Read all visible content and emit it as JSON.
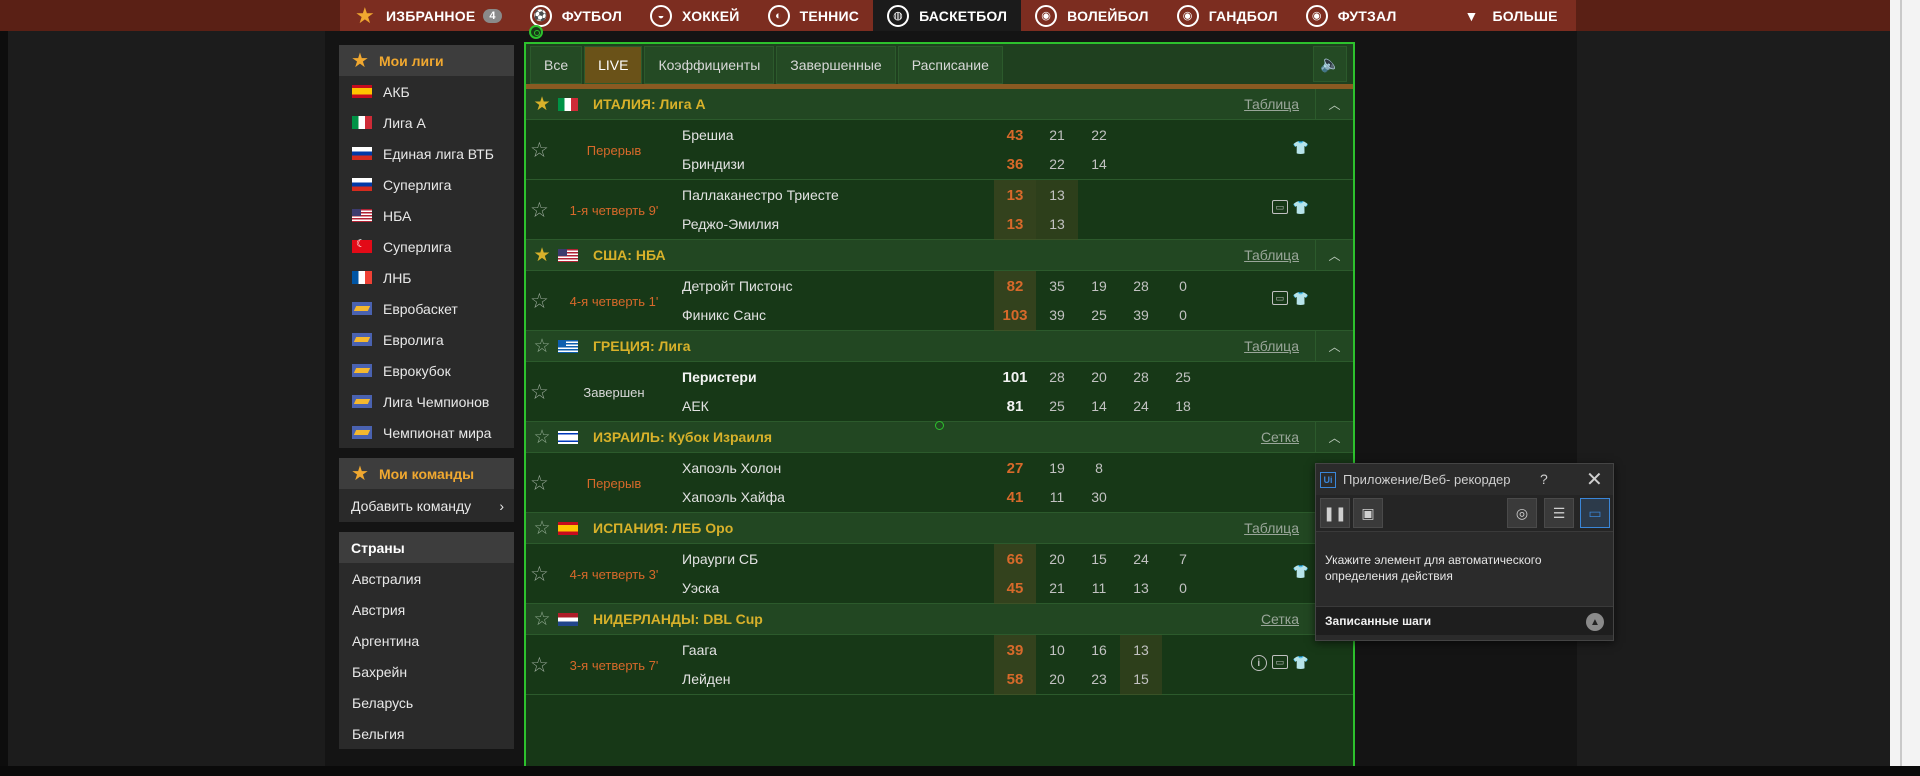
{
  "top_nav": {
    "items": [
      {
        "label": "ИЗБРАННОЕ",
        "icon": "star-icon",
        "badge": "4"
      },
      {
        "label": "ФУТБОЛ",
        "icon": "soccer-ball-icon"
      },
      {
        "label": "ХОККЕЙ",
        "icon": "hockey-puck-icon"
      },
      {
        "label": "ТЕННИС",
        "icon": "tennis-ball-icon"
      },
      {
        "label": "БАСКЕТБОЛ",
        "icon": "basketball-icon",
        "active": true
      },
      {
        "label": "ВОЛЕЙБОЛ",
        "icon": "volleyball-icon"
      },
      {
        "label": "ГАНДБОЛ",
        "icon": "handball-icon"
      },
      {
        "label": "ФУТЗАЛ",
        "icon": "futsal-ball-icon"
      },
      {
        "label": "БОЛЬШЕ",
        "icon": "triangle-down-icon"
      }
    ]
  },
  "sidebar": {
    "my_leagues_title": "Мои лиги",
    "leagues": [
      {
        "label": "АКБ",
        "flag": "es"
      },
      {
        "label": "Лига А",
        "flag": "it"
      },
      {
        "label": "Единая лига ВТБ",
        "flag": "ru"
      },
      {
        "label": "Суперлига",
        "flag": "ru"
      },
      {
        "label": "НБА",
        "flag": "us"
      },
      {
        "label": "Суперлига",
        "flag": "tr"
      },
      {
        "label": "ЛНБ",
        "flag": "fr"
      },
      {
        "label": "Евробаскет",
        "flag": "eu"
      },
      {
        "label": "Евролига",
        "flag": "eu"
      },
      {
        "label": "Еврокубок",
        "flag": "eu"
      },
      {
        "label": "Лига Чемпионов",
        "flag": "eu"
      },
      {
        "label": "Чемпионат мира",
        "flag": "eu"
      }
    ],
    "my_teams_title": "Мои команды",
    "add_team": "Добавить команду",
    "countries_title": "Страны",
    "countries": [
      "Австралия",
      "Австрия",
      "Аргентина",
      "Бахрейн",
      "Беларусь",
      "Бельгия"
    ]
  },
  "tabs": [
    "Все",
    "LIVE",
    "Коэффициенты",
    "Завершенные",
    "Расписание"
  ],
  "active_tab": "LIVE",
  "competitions": [
    {
      "name": "ИТАЛИЯ: Лига А",
      "flag": "it",
      "favorite": true,
      "link": "Таблица",
      "matches": [
        {
          "status": "Перерыв",
          "home": "Брешиа",
          "away": "Бриндизи",
          "home_total": "43",
          "away_total": "36",
          "home_parts": [
            "21",
            "22"
          ],
          "away_parts": [
            "22",
            "14"
          ],
          "icons": [
            "shirt-icon"
          ]
        },
        {
          "status": "1-я четверть 9'",
          "home": "Паллаканестро Триесте",
          "away": "Реджо-Эмилия",
          "home_total": "13",
          "away_total": "13",
          "home_parts": [
            "13"
          ],
          "away_parts": [
            "13"
          ],
          "icons": [
            "tv-icon",
            "shirt-icon"
          ]
        }
      ]
    },
    {
      "name": "США: НБА",
      "flag": "us",
      "favorite": true,
      "link": "Таблица",
      "matches": [
        {
          "status": "4-я четверть 1'",
          "home": "Детройт Пистонс",
          "away": "Финикс Санс",
          "home_total": "82",
          "away_total": "103",
          "home_parts": [
            "35",
            "19",
            "28",
            "0"
          ],
          "away_parts": [
            "39",
            "25",
            "39",
            "0"
          ],
          "icons": [
            "tv-icon",
            "shirt-icon"
          ]
        }
      ]
    },
    {
      "name": "ГРЕЦИЯ: Лига",
      "flag": "gr",
      "favorite": false,
      "link": "Таблица",
      "matches": [
        {
          "status": "Завершен",
          "finished": true,
          "home": "Перистери",
          "away": "АЕК",
          "home_total": "101",
          "away_total": "81",
          "home_parts": [
            "28",
            "20",
            "28",
            "25"
          ],
          "away_parts": [
            "25",
            "14",
            "24",
            "18"
          ],
          "icons": []
        }
      ]
    },
    {
      "name": "ИЗРАИЛЬ: Кубок Израиля",
      "flag": "il",
      "favorite": false,
      "link": "Сетка",
      "matches": [
        {
          "status": "Перерыв",
          "home": "Хапоэль Холон",
          "away": "Хапоэль Хайфа",
          "home_total": "27",
          "away_total": "41",
          "home_parts": [
            "19",
            "8"
          ],
          "away_parts": [
            "11",
            "30"
          ],
          "icons": []
        }
      ]
    },
    {
      "name": "ИСПАНИЯ: ЛЕБ Оро",
      "flag": "es",
      "favorite": false,
      "link": "Таблица",
      "matches": [
        {
          "status": "4-я четверть 3'",
          "home": "Ираурги СБ",
          "away": "Уэска",
          "home_total": "66",
          "away_total": "45",
          "home_parts": [
            "20",
            "15",
            "24",
            "7"
          ],
          "away_parts": [
            "21",
            "11",
            "13",
            "0"
          ],
          "icons": [
            "shirt-icon"
          ]
        }
      ]
    },
    {
      "name": "НИДЕРЛАНДЫ: DBL Cup",
      "flag": "nl",
      "favorite": false,
      "link": "Сетка",
      "matches": [
        {
          "status": "3-я четверть 7'",
          "home": "Гаага",
          "away": "Лейден",
          "home_total": "39",
          "away_total": "58",
          "home_parts": [
            "10",
            "16",
            "13"
          ],
          "away_parts": [
            "20",
            "23",
            "15"
          ],
          "icons": [
            "info-icon",
            "tv-icon",
            "shirt-icon"
          ]
        }
      ]
    }
  ],
  "recorder": {
    "title": "Приложение/Веб- рекордер",
    "help": "?",
    "close": "✕",
    "message": "Укажите элемент для автоматического определения действия",
    "steps_label": "Записанные шаги"
  },
  "colors": {
    "nav": "#7c2d20",
    "main_bg": "#173817",
    "accent_orange": "#d7692a",
    "accent_gold": "#d8b12a",
    "selection_border": "#2dc12d"
  }
}
